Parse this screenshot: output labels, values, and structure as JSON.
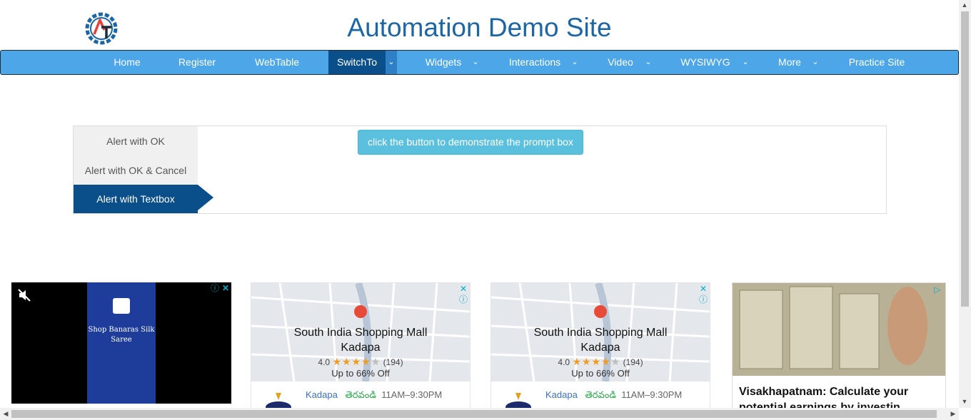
{
  "header": {
    "title": "Automation Demo Site"
  },
  "nav": {
    "items": [
      {
        "label": "Home"
      },
      {
        "label": "Register"
      },
      {
        "label": "WebTable"
      },
      {
        "label": "SwitchTo"
      },
      {
        "label": "Widgets"
      },
      {
        "label": "Interactions"
      },
      {
        "label": "Video"
      },
      {
        "label": "WYSIWYG"
      },
      {
        "label": "More"
      },
      {
        "label": "Practice Site"
      }
    ],
    "active": "SwitchTo",
    "active_color": "#0b4f8a",
    "bar_color": "#4da6e8"
  },
  "alerts": {
    "tabs": [
      {
        "label": "Alert with OK"
      },
      {
        "label": "Alert with OK & Cancel"
      },
      {
        "label": "Alert with Textbox"
      }
    ],
    "active_tab": "Alert with Textbox",
    "prompt_button": "click the button to demonstrate the prompt box"
  },
  "ads": {
    "ad1": {
      "text": "Shop Banaras Silk Saree"
    },
    "map_ads": [
      {
        "title_line1": "South India Shopping Mall",
        "title_line2": "Kadapa",
        "rating": "4.0",
        "reviews": "(194)",
        "offer": "Up to 66% Off",
        "city": "Kadapa",
        "status": "తెరవండి",
        "hours": "11AM–9:30PM"
      },
      {
        "title_line1": "South India Shopping Mall",
        "title_line2": "Kadapa",
        "rating": "4.0",
        "reviews": "(194)",
        "offer": "Up to 66% Off",
        "city": "Kadapa",
        "status": "తెరవండి",
        "hours": "11AM–9:30PM"
      }
    ],
    "ad4": {
      "headline": "Visakhapatnam: Calculate your potential earnings by investin"
    }
  }
}
